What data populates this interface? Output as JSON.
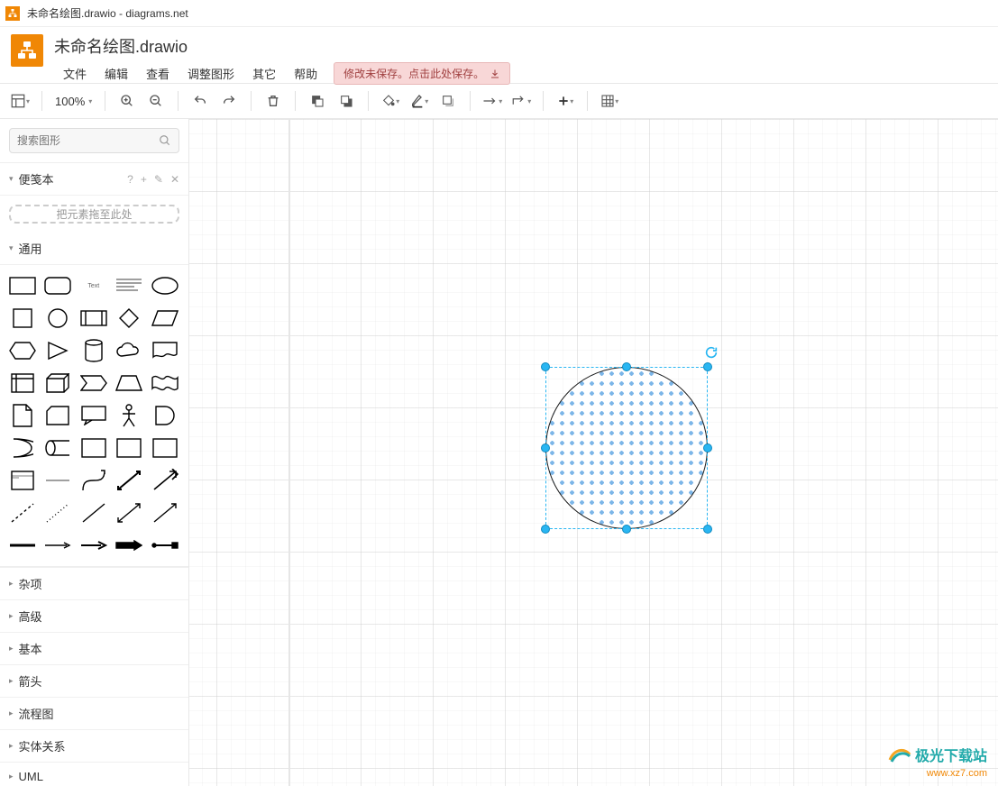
{
  "window": {
    "title": "未命名绘图.drawio - diagrams.net"
  },
  "document": {
    "title": "未命名绘图.drawio"
  },
  "menu": {
    "file": "文件",
    "edit": "编辑",
    "view": "查看",
    "adjust": "调整图形",
    "other": "其它",
    "help": "帮助"
  },
  "save_warning": "修改未保存。点击此处保存。",
  "toolbar": {
    "zoom": "100%"
  },
  "sidebar": {
    "search_placeholder": "搜索图形",
    "scratchpad": {
      "title": "便笺本",
      "help": "?",
      "dropzone": "把元素拖至此处"
    },
    "general": "通用",
    "text_label": "Text",
    "categories": {
      "misc": "杂项",
      "advanced": "高级",
      "basic": "基本",
      "arrows": "箭头",
      "flowchart": "流程图",
      "er": "实体关系",
      "uml": "UML"
    }
  },
  "watermark": {
    "line1": "极光下载站",
    "line2": "www.xz7.com"
  }
}
